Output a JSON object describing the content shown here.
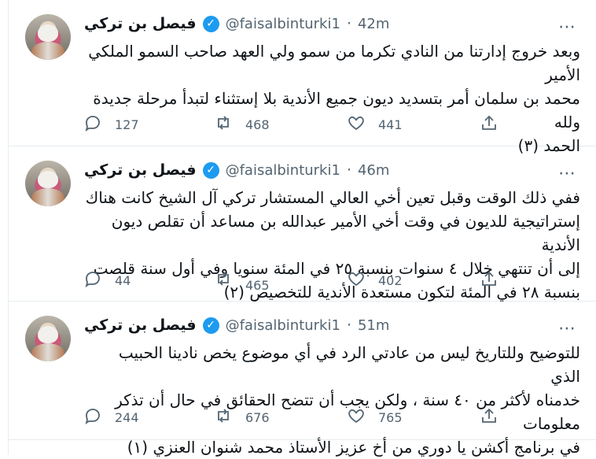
{
  "tweets": [
    {
      "name": "فيصل بن تركي",
      "verified": "✓",
      "handle": "@faisalbinturki1",
      "dot": "·",
      "time": "42m",
      "text": "وبعد خروج إدارتنا من النادي تكرما من سمو ولي العهد صاحب السمو الملكي الأمير\nمحمد بن سلمان أمر بتسديد ديون جميع الأندية بلا إستثناء لتبدأ مرحلة جديدة ولله\nالحمد (٣)",
      "replies": "127",
      "retweets": "468",
      "likes": "441"
    },
    {
      "name": "فيصل بن تركي",
      "verified": "✓",
      "handle": "@faisalbinturki1",
      "dot": "·",
      "time": "46m",
      "text": "ففي ذلك الوقت وقبل تعين أخي العالي المستشار تركي آل الشيخ كانت هناك\nإستراتيجية للديون في وقت أخي الأمير عبدالله بن مساعد أن تقلص ديون الأندية\nإلى أن تنتهي خلال ٤ سنوات بنسبة ٢٥ في المئة سنويا وفي أول سنة قلصت\nبنسبة ٢٨ في المئة لتكون مستعدة الأندية للتخصيص (٢)",
      "replies": "44",
      "retweets": "465",
      "likes": "402"
    },
    {
      "name": "فيصل بن تركي",
      "verified": "✓",
      "handle": "@faisalbinturki1",
      "dot": "·",
      "time": "51m",
      "text": "للتوضيح وللتاريخ ليس من عادتي الرد في أي موضوع يخص نادينا الحبيب الذي\nخدمناه لأكثر من ٤٠ سنة ، ولكن يجب أن تتضح الحقائق في حال أن تذكر معلومات\nفي برنامج أكشن يا دوري من أخ عزيز الأستاذ محمد شنوان العنزي (١)",
      "replies": "244",
      "retweets": "676",
      "likes": "765"
    }
  ]
}
